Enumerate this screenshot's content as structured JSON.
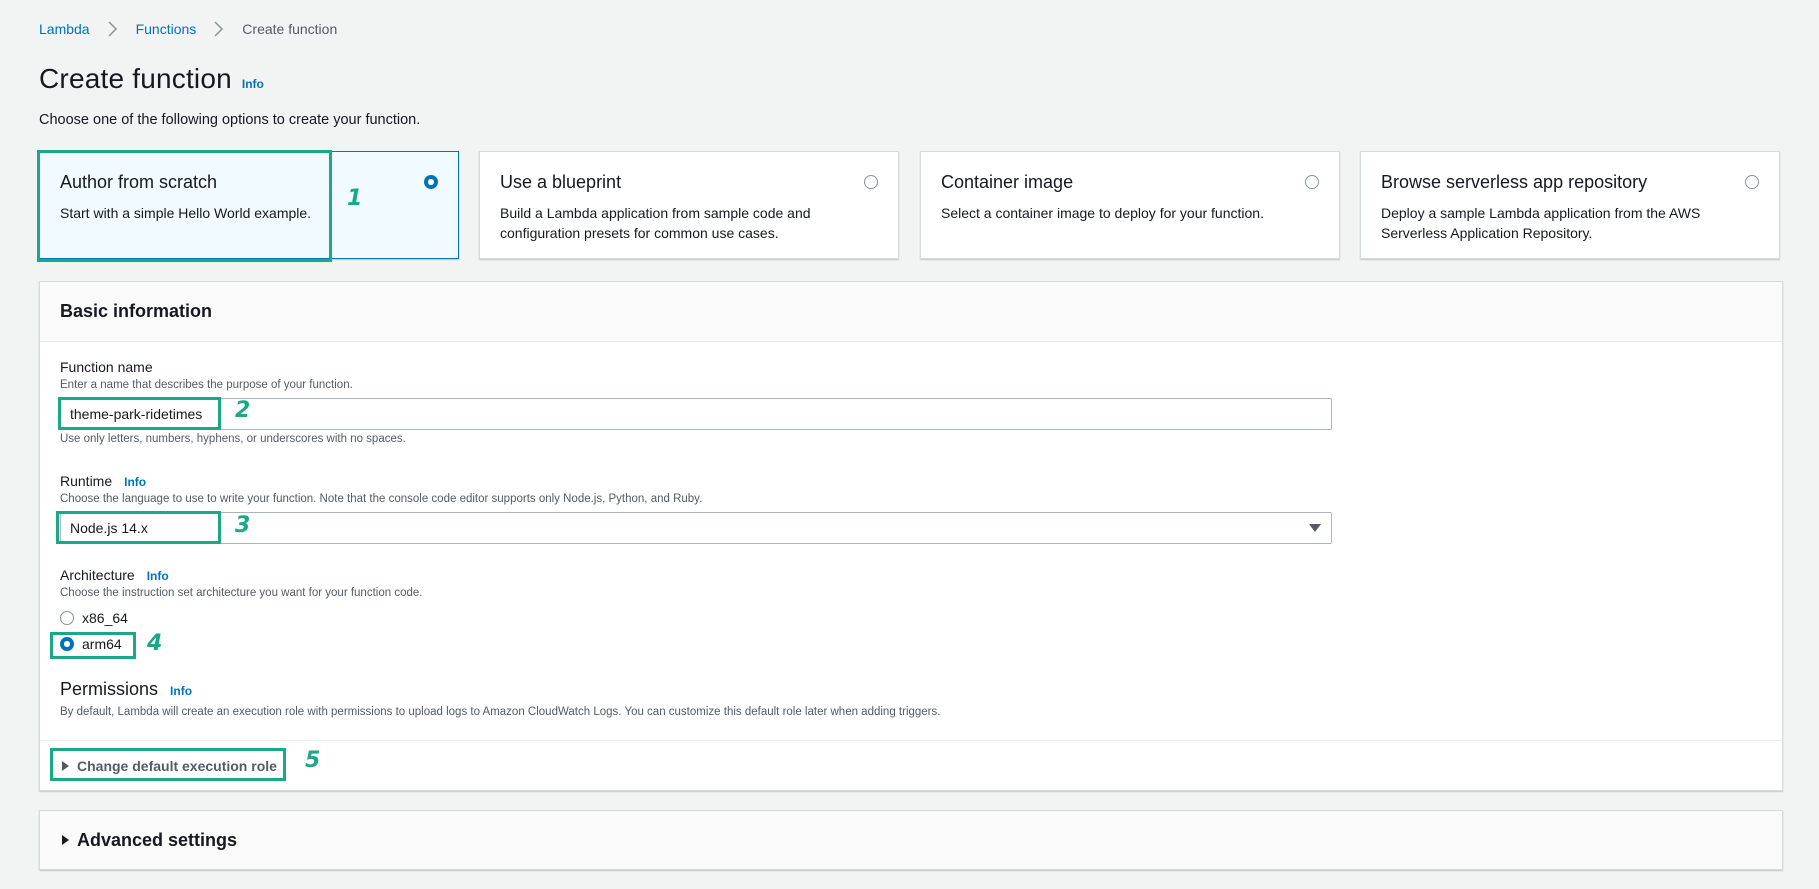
{
  "breadcrumb": {
    "items": [
      "Lambda",
      "Functions"
    ],
    "current": "Create function"
  },
  "header": {
    "title": "Create function",
    "info": "Info",
    "description": "Choose one of the following options to create your function."
  },
  "options": [
    {
      "title": "Author from scratch",
      "description": "Start with a simple Hello World example.",
      "selected": true
    },
    {
      "title": "Use a blueprint",
      "description": "Build a Lambda application from sample code and configuration presets for common use cases.",
      "selected": false
    },
    {
      "title": "Container image",
      "description": "Select a container image to deploy for your function.",
      "selected": false
    },
    {
      "title": "Browse serverless app repository",
      "description": "Deploy a sample Lambda application from the AWS Serverless Application Repository.",
      "selected": false
    }
  ],
  "basic": {
    "title": "Basic information",
    "function_name": {
      "label": "Function name",
      "hint": "Enter a name that describes the purpose of your function.",
      "value": "theme-park-ridetimes",
      "constraint": "Use only letters, numbers, hyphens, or underscores with no spaces."
    },
    "runtime": {
      "label": "Runtime",
      "info": "Info",
      "hint": "Choose the language to use to write your function. Note that the console code editor supports only Node.js, Python, and Ruby.",
      "value": "Node.js 14.x"
    },
    "architecture": {
      "label": "Architecture",
      "info": "Info",
      "hint": "Choose the instruction set architecture you want for your function code.",
      "options": [
        "x86_64",
        "arm64"
      ],
      "selected": "arm64"
    },
    "permissions": {
      "title": "Permissions",
      "info": "Info",
      "description": "By default, Lambda will create an execution role with permissions to upload logs to Amazon CloudWatch Logs. You can customize this default role later when adding triggers."
    },
    "change_role": "Change default execution role"
  },
  "advanced": {
    "title": "Advanced settings"
  },
  "annotations": [
    "1",
    "2",
    "3",
    "4",
    "5"
  ],
  "colors": {
    "accent": "#0073bb",
    "annotation": "#1aa886"
  }
}
